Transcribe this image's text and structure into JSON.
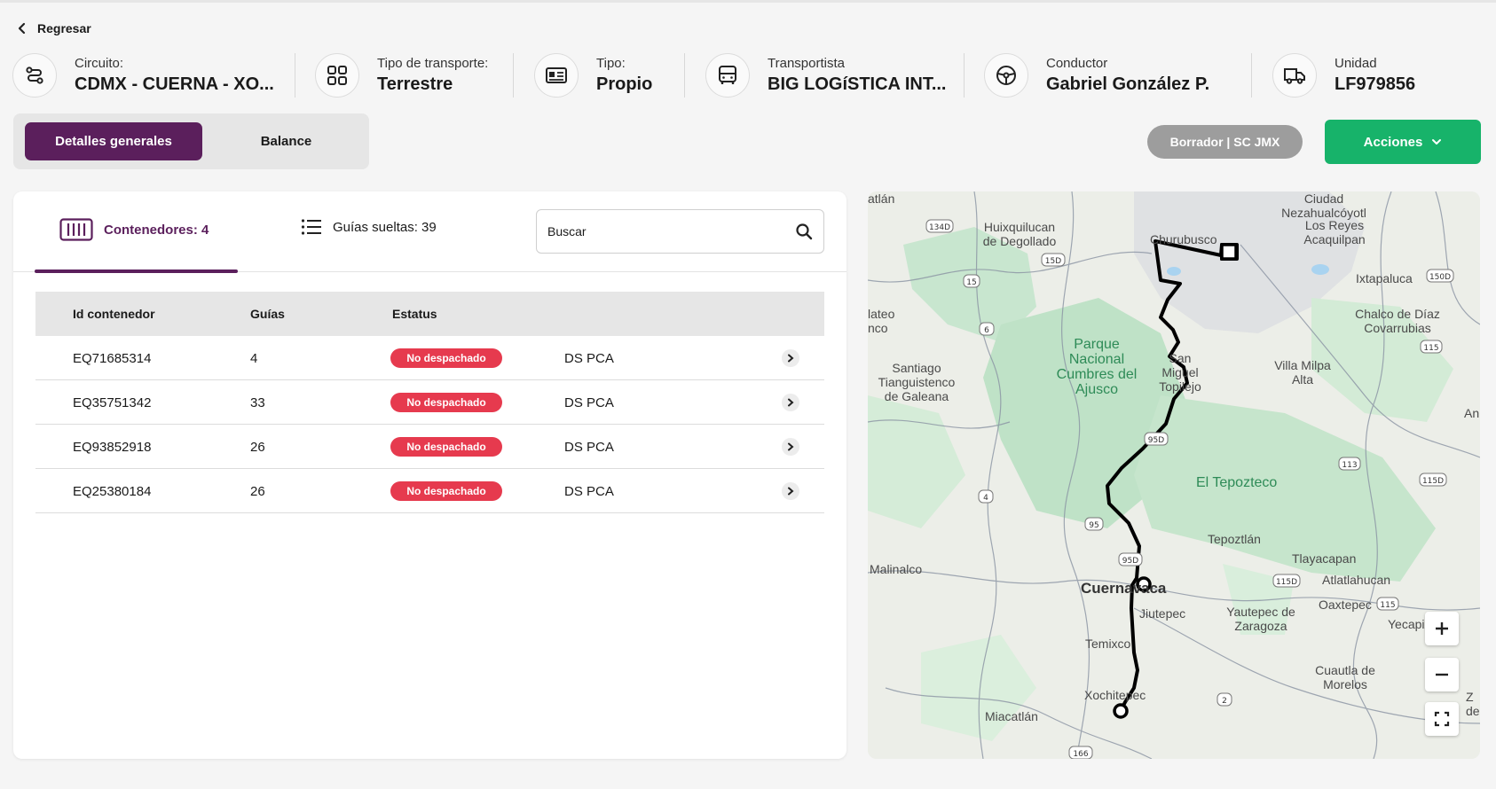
{
  "back": {
    "label": "Regresar"
  },
  "info": [
    {
      "label": "Circuito:",
      "value": "CDMX - CUERNA - XO...",
      "icon": "route-icon"
    },
    {
      "label": "Tipo de transporte:",
      "value": "Terrestre",
      "icon": "grid-icon"
    },
    {
      "label": "Tipo:",
      "value": "Propio",
      "icon": "id-card-icon"
    },
    {
      "label": "Transportista",
      "value": "BIG LOGíSTICA INT...",
      "icon": "bus-icon"
    },
    {
      "label": "Conductor",
      "value": "Gabriel González P.",
      "icon": "steering-wheel-icon"
    },
    {
      "label": "Unidad",
      "value": "LF979856",
      "icon": "truck-icon"
    }
  ],
  "tabs": {
    "general": "Detalles generales",
    "balance": "Balance"
  },
  "status_badge": "Borrador | SC JMX",
  "actions": {
    "label": "Acciones"
  },
  "content_tabs": {
    "containers": "Contenedores: 4",
    "loose_guides": "Guías sueltas: 39"
  },
  "search": {
    "placeholder": "Buscar"
  },
  "table": {
    "headers": [
      "Id contenedor",
      "Guías",
      "Estatus"
    ],
    "rows": [
      {
        "id": "EQ71685314",
        "guides": "4",
        "status": "No despachado",
        "location": "DS PCA"
      },
      {
        "id": "EQ35751342",
        "guides": "33",
        "status": "No despachado",
        "location": "DS PCA"
      },
      {
        "id": "EQ93852918",
        "guides": "26",
        "status": "No despachado",
        "location": "DS PCA"
      },
      {
        "id": "EQ25380184",
        "guides": "26",
        "status": "No despachado",
        "location": "DS PCA"
      }
    ]
  },
  "map": {
    "labels": {
      "atlan": "atlán",
      "huixquilucan": "Huixquilucan de Degollado",
      "churubusco": "Churubusco",
      "ciudad_nezahualcoyotl": "Ciudad Nezahualcóyotl",
      "los_reyes": "Los Reyes Acaquilpan",
      "ixtapaluca": "Ixtapaluca",
      "chalco": "Chalco de Díaz Covarrubias",
      "lateo": "lateo nco",
      "parque": "Parque Nacional Cumbres del Ajusco",
      "san_miguel": "San Miguel Topilejo",
      "villa_milpa": "Villa Milpa Alta",
      "santiago": "Santiago Tianguistenco de Galeana",
      "tepozteco": "El Tepozteco",
      "tepoztlan": "Tepoztlán",
      "tlayacapan": "Tlayacapan",
      "malinalco": "Malinalco",
      "atlatlahucan": "Atlatlahucan",
      "cuernavaca": "Cuernavaca",
      "jiutepec": "Jiutepec",
      "yautepec": "Yautepec de Zaragoza",
      "oaxtepec": "Oaxtepec",
      "yecapixtla": "Yecapixtla",
      "temixco": "Temixco",
      "cuautla": "Cuautla de Morelos",
      "xochitepec": "Xochitepec",
      "miacatlan": "Miacatlán",
      "an": "An",
      "z": "Z de"
    },
    "shields": [
      "134D",
      "15D",
      "15",
      "6",
      "150D",
      "115",
      "95D",
      "113",
      "115D",
      "4",
      "95",
      "95D",
      "115D",
      "115",
      "2",
      "166"
    ],
    "zoom_in": "+",
    "zoom_out": "−"
  },
  "colors": {
    "brand": "#5b1f5c",
    "accent_green": "#17b36a",
    "danger": "#e63a4e",
    "draft_grey": "#9d9d9d"
  }
}
